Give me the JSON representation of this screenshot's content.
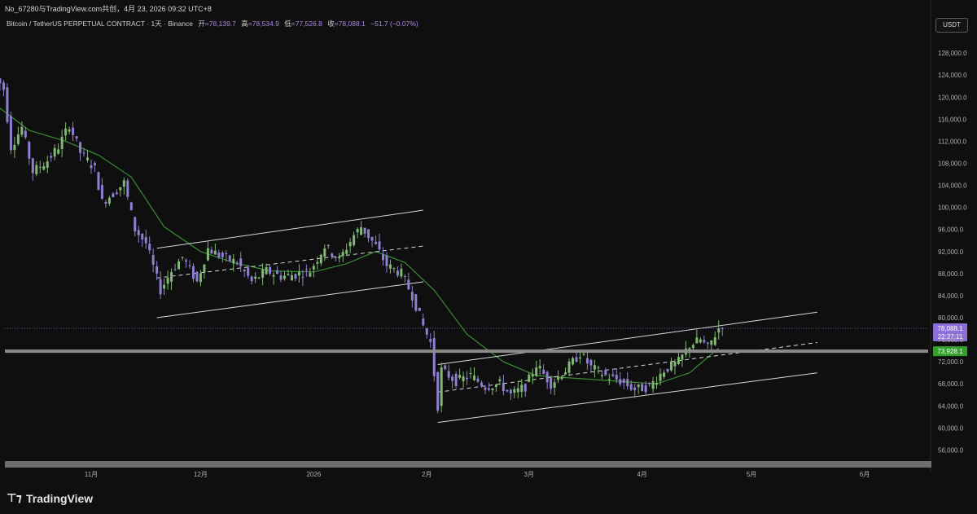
{
  "header": {
    "watermark": "No_67280与TradingView.com共创，4月 23, 2026 09:32 UTC+8",
    "symbol": "Bitcoin / TetherUS PERPETUAL CONTRACT · 1天 · Binance",
    "ohlc": [
      {
        "label": "开",
        "value": "=78,139.7"
      },
      {
        "label": "高",
        "value": "=78,534.9"
      },
      {
        "label": "低",
        "value": "=77,526.8"
      },
      {
        "label": "收",
        "value": "=78,088.1"
      }
    ],
    "change": "−51.7 (−0.07%)",
    "currency_button": "USDT"
  },
  "footer": {
    "brand": "TradingView"
  },
  "colors": {
    "background": "#0f0f0f",
    "candle_up": "#7fb972",
    "candle_down": "#8f7fd0",
    "ma": "#3d8b37",
    "channel": "#d8d8d8",
    "last_price": "#8e6fd8",
    "level": "#33a02c"
  },
  "chart_data": {
    "type": "candlestick",
    "timeframe": "1天",
    "y_axis": {
      "ylim": [
        54000,
        129500
      ],
      "ticks": [
        "56,000.0",
        "60,000.0",
        "64,000.0",
        "68,000.0",
        "72,000.0",
        "76,000.0",
        "80,000.0",
        "84,000.0",
        "88,000.0",
        "92,000.0",
        "96,000.0",
        "100,000.0",
        "104,000.0",
        "108,000.0",
        "112,000.0",
        "116,000.0",
        "120,000.0",
        "124,000.0",
        "128,000.0"
      ]
    },
    "x_axis": {
      "ticks": [
        {
          "label": "11月",
          "date": "2025-11-01"
        },
        {
          "label": "12月",
          "date": "2025-12-01"
        },
        {
          "label": "2026",
          "date": "2026-01-01"
        },
        {
          "label": "2月",
          "date": "2026-02-01"
        },
        {
          "label": "3月",
          "date": "2026-03-01"
        },
        {
          "label": "4月",
          "date": "2026-04-01"
        },
        {
          "label": "5月",
          "date": "2026-05-01"
        },
        {
          "label": "6月",
          "date": "2026-06-01"
        }
      ]
    },
    "price_path": [
      {
        "date": "2025-10-06",
        "price": 124500
      },
      {
        "date": "2025-10-09",
        "price": 121500
      },
      {
        "date": "2025-10-11",
        "price": 111000
      },
      {
        "date": "2025-10-14",
        "price": 114500
      },
      {
        "date": "2025-10-17",
        "price": 106500
      },
      {
        "date": "2025-10-21",
        "price": 108500
      },
      {
        "date": "2025-10-24",
        "price": 111000
      },
      {
        "date": "2025-10-27",
        "price": 115000
      },
      {
        "date": "2025-10-30",
        "price": 110000
      },
      {
        "date": "2025-11-03",
        "price": 107000
      },
      {
        "date": "2025-11-05",
        "price": 101000
      },
      {
        "date": "2025-11-08",
        "price": 102500
      },
      {
        "date": "2025-11-11",
        "price": 104500
      },
      {
        "date": "2025-11-14",
        "price": 96000
      },
      {
        "date": "2025-11-17",
        "price": 93500
      },
      {
        "date": "2025-11-21",
        "price": 85000
      },
      {
        "date": "2025-11-24",
        "price": 88500
      },
      {
        "date": "2025-11-27",
        "price": 91000
      },
      {
        "date": "2025-12-01",
        "price": 86500
      },
      {
        "date": "2025-12-04",
        "price": 92500
      },
      {
        "date": "2025-12-08",
        "price": 91000
      },
      {
        "date": "2025-12-12",
        "price": 90000
      },
      {
        "date": "2025-12-16",
        "price": 86500
      },
      {
        "date": "2025-12-20",
        "price": 88500
      },
      {
        "date": "2025-12-24",
        "price": 87500
      },
      {
        "date": "2025-12-28",
        "price": 87800
      },
      {
        "date": "2026-01-01",
        "price": 88500
      },
      {
        "date": "2026-01-05",
        "price": 93000
      },
      {
        "date": "2026-01-09",
        "price": 90500
      },
      {
        "date": "2026-01-13",
        "price": 95000
      },
      {
        "date": "2026-01-15",
        "price": 96500
      },
      {
        "date": "2026-01-19",
        "price": 93000
      },
      {
        "date": "2026-01-22",
        "price": 89500
      },
      {
        "date": "2026-01-26",
        "price": 88000
      },
      {
        "date": "2026-01-29",
        "price": 84000
      },
      {
        "date": "2026-02-01",
        "price": 78500
      },
      {
        "date": "2026-02-03",
        "price": 75500
      },
      {
        "date": "2026-02-05",
        "price": 64000
      },
      {
        "date": "2026-02-06",
        "price": 70500
      },
      {
        "date": "2026-02-10",
        "price": 68500
      },
      {
        "date": "2026-02-14",
        "price": 69500
      },
      {
        "date": "2026-02-18",
        "price": 67500
      },
      {
        "date": "2026-02-22",
        "price": 68000
      },
      {
        "date": "2026-02-25",
        "price": 66000
      },
      {
        "date": "2026-03-01",
        "price": 67500
      },
      {
        "date": "2026-03-04",
        "price": 71500
      },
      {
        "date": "2026-03-08",
        "price": 68000
      },
      {
        "date": "2026-03-12",
        "price": 70500
      },
      {
        "date": "2026-03-16",
        "price": 73500
      },
      {
        "date": "2026-03-19",
        "price": 71000
      },
      {
        "date": "2026-03-23",
        "price": 69500
      },
      {
        "date": "2026-03-27",
        "price": 68500
      },
      {
        "date": "2026-03-31",
        "price": 67000
      },
      {
        "date": "2026-04-04",
        "price": 67500
      },
      {
        "date": "2026-04-08",
        "price": 70500
      },
      {
        "date": "2026-04-12",
        "price": 72000
      },
      {
        "date": "2026-04-15",
        "price": 75000
      },
      {
        "date": "2026-04-18",
        "price": 76000
      },
      {
        "date": "2026-04-20",
        "price": 74500
      },
      {
        "date": "2026-04-23",
        "price": 78088.1
      }
    ],
    "moving_average": [
      {
        "date": "2025-10-06",
        "price": 118500
      },
      {
        "date": "2025-10-15",
        "price": 114000
      },
      {
        "date": "2025-10-25",
        "price": 112000
      },
      {
        "date": "2025-11-03",
        "price": 109500
      },
      {
        "date": "2025-11-12",
        "price": 105500
      },
      {
        "date": "2025-11-21",
        "price": 96500
      },
      {
        "date": "2025-12-01",
        "price": 92000
      },
      {
        "date": "2025-12-10",
        "price": 90000
      },
      {
        "date": "2025-12-20",
        "price": 88500
      },
      {
        "date": "2026-01-01",
        "price": 88300
      },
      {
        "date": "2026-01-10",
        "price": 89800
      },
      {
        "date": "2026-01-18",
        "price": 92000
      },
      {
        "date": "2026-01-26",
        "price": 90000
      },
      {
        "date": "2026-02-03",
        "price": 85000
      },
      {
        "date": "2026-02-12",
        "price": 77000
      },
      {
        "date": "2026-02-22",
        "price": 72000
      },
      {
        "date": "2026-03-03",
        "price": 69500
      },
      {
        "date": "2026-03-14",
        "price": 69000
      },
      {
        "date": "2026-03-25",
        "price": 68500
      },
      {
        "date": "2026-04-05",
        "price": 68000
      },
      {
        "date": "2026-04-14",
        "price": 70000
      },
      {
        "date": "2026-04-22",
        "price": 74500
      }
    ],
    "channels": [
      {
        "from": {
          "date": "2025-11-19",
          "price": 92600
        },
        "to": {
          "date": "2026-01-31",
          "price": 99500
        },
        "style": "solid"
      },
      {
        "from": {
          "date": "2025-11-19",
          "price": 87200
        },
        "to": {
          "date": "2026-01-31",
          "price": 93000
        },
        "style": "dashed"
      },
      {
        "from": {
          "date": "2025-11-19",
          "price": 80000
        },
        "to": {
          "date": "2026-01-31",
          "price": 86500
        },
        "style": "solid"
      },
      {
        "from": {
          "date": "2026-02-04",
          "price": 71500
        },
        "to": {
          "date": "2026-05-19",
          "price": 81000
        },
        "style": "solid"
      },
      {
        "from": {
          "date": "2026-02-04",
          "price": 66500
        },
        "to": {
          "date": "2026-05-19",
          "price": 75500
        },
        "style": "dashed"
      },
      {
        "from": {
          "date": "2026-02-04",
          "price": 61000
        },
        "to": {
          "date": "2026-05-19",
          "price": 70000
        },
        "style": "solid"
      }
    ],
    "horizontal_level": {
      "price": 73928.1,
      "label": "73,928.1"
    },
    "last_price": {
      "price": 78088.1,
      "label": "78,088.1",
      "countdown": "22:27:11"
    }
  }
}
